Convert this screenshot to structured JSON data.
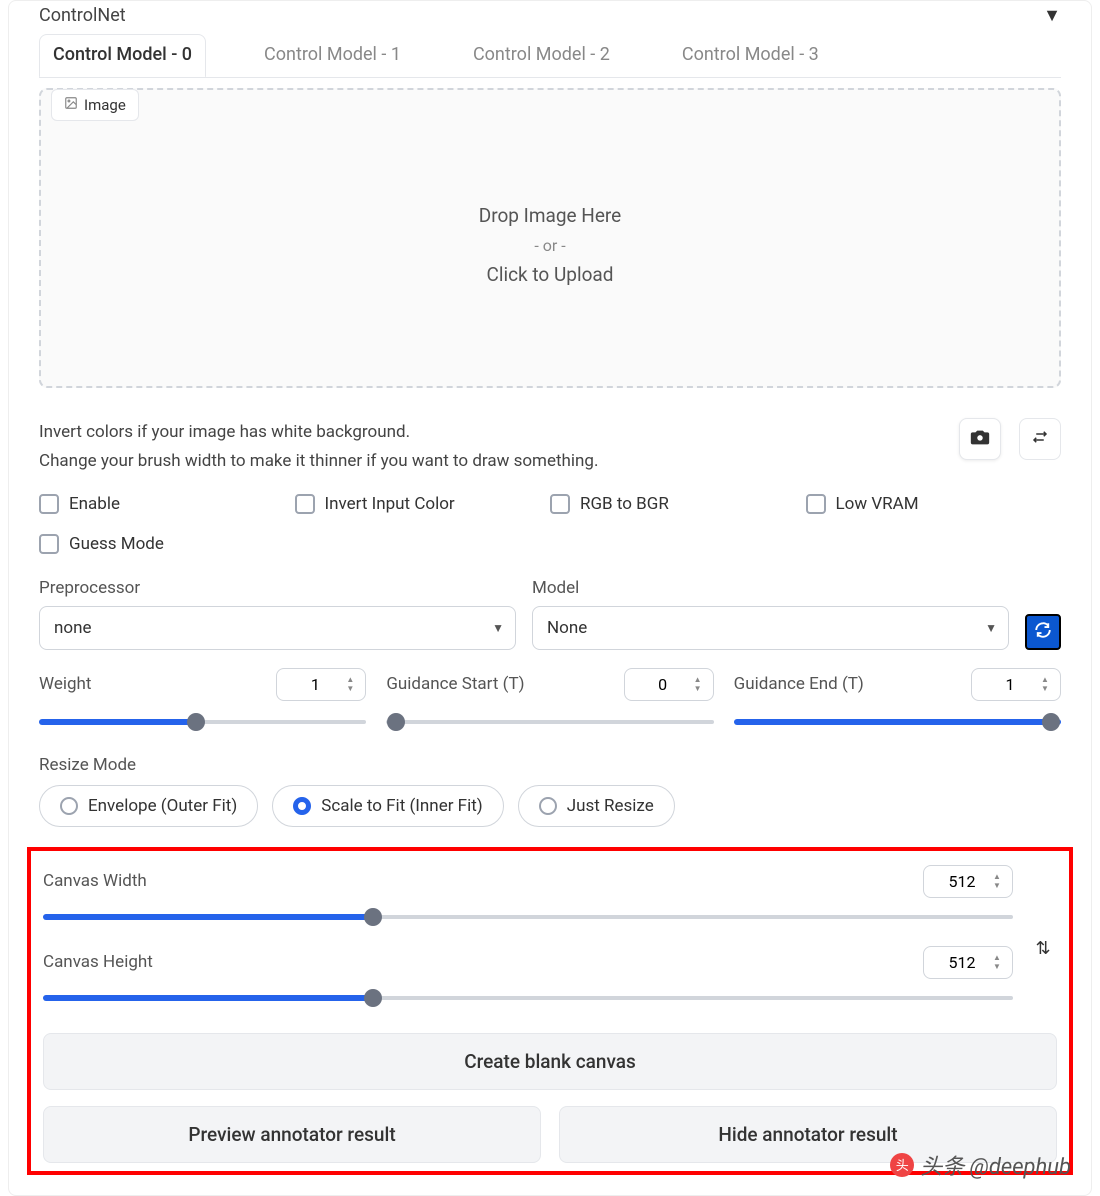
{
  "header": {
    "title": "ControlNet"
  },
  "tabs": [
    "Control Model - 0",
    "Control Model - 1",
    "Control Model - 2",
    "Control Model - 3"
  ],
  "active_tab": 0,
  "image_tab_label": "Image",
  "drop": {
    "line1": "Drop Image Here",
    "or": "- or -",
    "line2": "Click to Upload"
  },
  "hint": {
    "line1": "Invert colors if your image has white background.",
    "line2": "Change your brush width to make it thinner if you want to draw something."
  },
  "checkboxes": [
    "Enable",
    "Invert Input Color",
    "RGB to BGR",
    "Low VRAM",
    "Guess Mode"
  ],
  "preprocessor": {
    "label": "Preprocessor",
    "value": "none"
  },
  "model": {
    "label": "Model",
    "value": "None"
  },
  "sliders": {
    "weight": {
      "label": "Weight",
      "value": 1,
      "fill_pct": 48
    },
    "gstart": {
      "label": "Guidance Start (T)",
      "value": 0,
      "fill_pct": 0
    },
    "gend": {
      "label": "Guidance End (T)",
      "value": 1,
      "fill_pct": 100
    }
  },
  "resize": {
    "label": "Resize Mode",
    "options": [
      "Envelope (Outer Fit)",
      "Scale to Fit (Inner Fit)",
      "Just Resize"
    ],
    "selected": 1
  },
  "canvas": {
    "width": {
      "label": "Canvas Width",
      "value": 512,
      "fill_pct": 34
    },
    "height": {
      "label": "Canvas Height",
      "value": 512,
      "fill_pct": 34
    }
  },
  "buttons": {
    "blank": "Create blank canvas",
    "preview": "Preview annotator result",
    "hide": "Hide annotator result"
  },
  "watermark": "头条 @deephub"
}
